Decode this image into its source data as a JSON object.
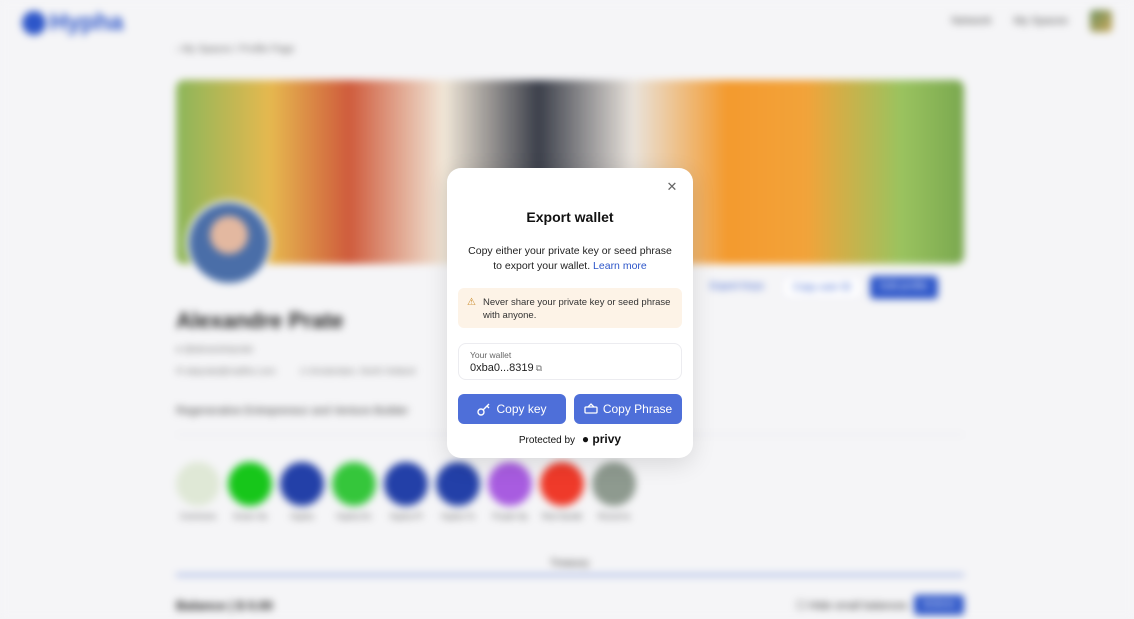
{
  "app": {
    "logo_text": "Hypha"
  },
  "nav": {
    "network": "Network",
    "my_spaces": "My Spaces"
  },
  "breadcrumb": {
    "parent": "My Spaces",
    "separator": "/",
    "current": "Profile Page"
  },
  "profile": {
    "name": "Alexandre Prate",
    "handle": "@alexandreprate",
    "email": "aleprate@mailfox.com",
    "location": "Amsterdam, North Holland",
    "bio": "Regenerative Entrepreneur and Venture Builder"
  },
  "profile_actions": {
    "export_keys": "Export Keys",
    "copy_user_id": "Copy user ID",
    "edit_profile": "Edit profile"
  },
  "spaces": [
    {
      "label": "Commons",
      "color": "#dfe8d6"
    },
    {
      "label": "Green Sa",
      "color": "#17c61a"
    },
    {
      "label": "Hypha",
      "color": "#2340a8"
    },
    {
      "label": "Hypha En",
      "color": "#35c63b"
    },
    {
      "label": "Hypha Pl",
      "color": "#2340a8"
    },
    {
      "label": "Hypha To",
      "color": "#2340a8"
    },
    {
      "label": "Purple Sp",
      "color": "#a85ce0"
    },
    {
      "label": "Red Sandb",
      "color": "#ef3a2a"
    },
    {
      "label": "Round la",
      "color": "#8e9a8f"
    }
  ],
  "tabs": {
    "treasury": "Treasury"
  },
  "treasury": {
    "balance": "Balance | $ 0.00",
    "hide_small": "Hide small balances",
    "actions": "Actions"
  },
  "modal": {
    "title": "Export wallet",
    "description": "Copy either your private key or seed phrase to export your wallet.",
    "learn_more": "Learn more",
    "warning": "Never share your private key or seed phrase with anyone.",
    "wallet_label": "Your wallet",
    "wallet_address": "0xba0...8319",
    "copy_key": "Copy key",
    "copy_phrase": "Copy Phrase",
    "protected_by": "Protected by",
    "brand": "privy"
  },
  "colors": {
    "accent": "#2d56c9",
    "button": "#4e6fd9",
    "warning_bg": "#fdf3e7"
  }
}
